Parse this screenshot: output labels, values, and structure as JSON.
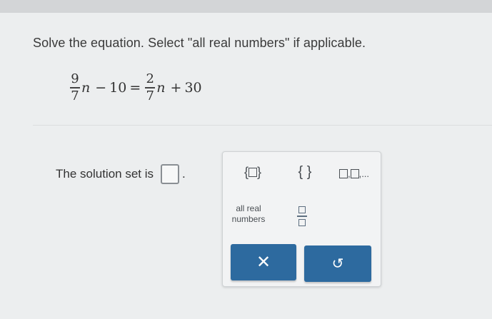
{
  "prompt": "Solve the equation. Select \"all real numbers\" if applicable.",
  "equation": {
    "lhs_num": "9",
    "lhs_den": "7",
    "lhs_var": "n",
    "lhs_op": "−",
    "lhs_const": "10",
    "equals": "=",
    "rhs_num": "2",
    "rhs_den": "7",
    "rhs_var": "n",
    "rhs_op": "+",
    "rhs_const": "30"
  },
  "answer": {
    "label": "The solution set is",
    "period": "."
  },
  "palette": {
    "set_brace_left": "{",
    "set_brace_right": "}",
    "empty_set": "{ }",
    "list_suffix": ",...",
    "all_real": "all real numbers",
    "clear_symbol": "✕",
    "undo_symbol": "↺"
  },
  "colors": {
    "accent": "#2d6a9f",
    "background": "#eceeef"
  }
}
